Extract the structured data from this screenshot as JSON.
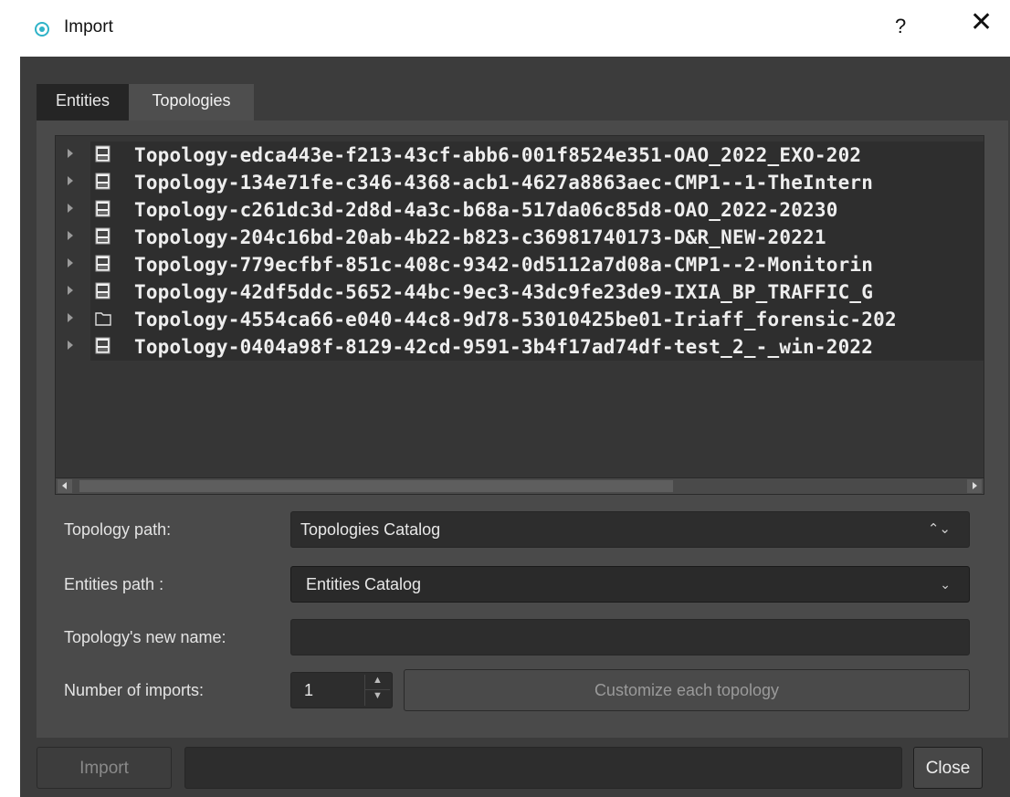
{
  "dialog": {
    "title": "Import",
    "help_label": "?",
    "close_glyph": "✕"
  },
  "tabs": [
    {
      "label": "Entities",
      "active": false
    },
    {
      "label": "Topologies",
      "active": true
    }
  ],
  "tree": {
    "rows": [
      {
        "label": "Topology-edca443e-f213-43cf-abb6-001f8524e351-OAO_2022_EXO-202",
        "icon": "topology-file-icon"
      },
      {
        "label": "Topology-134e71fe-c346-4368-acb1-4627a8863aec-CMP1--1-TheIntern",
        "icon": "topology-file-icon"
      },
      {
        "label": "Topology-c261dc3d-2d8d-4a3c-b68a-517da06c85d8-OAO_2022-20230",
        "icon": "topology-file-icon"
      },
      {
        "label": "Topology-204c16bd-20ab-4b22-b823-c36981740173-D&R_NEW-20221",
        "icon": "topology-file-icon"
      },
      {
        "label": "Topology-779ecfbf-851c-408c-9342-0d5112a7d08a-CMP1--2-Monitorin",
        "icon": "topology-file-icon"
      },
      {
        "label": "Topology-42df5ddc-5652-44bc-9ec3-43dc9fe23de9-IXIA_BP_TRAFFIC_G",
        "icon": "topology-file-icon"
      },
      {
        "label": "Topology-4554ca66-e040-44c8-9d78-53010425be01-Iriaff_forensic-202",
        "icon": "folder-icon"
      },
      {
        "label": "Topology-0404a98f-8129-42cd-9591-3b4f17ad74df-test_2_-_win-2022",
        "icon": "topology-file-icon"
      }
    ]
  },
  "form": {
    "topology_path_label": "Topology path:",
    "topology_path_value": "Topologies Catalog",
    "entities_path_label": "Entities path :",
    "entities_path_value": "Entities Catalog",
    "new_name_label": "Topology's new name:",
    "new_name_value": "",
    "imports_label": "Number of imports:",
    "imports_value": "1",
    "customize_label": "Customize each topology"
  },
  "footer": {
    "import_label": "Import",
    "status_text": "",
    "close_label": "Close"
  },
  "colors": {
    "accent": "#2fb3c8",
    "window_bg": "#3c3c3c",
    "panel_bg": "#4a4a4a",
    "tree_bg": "#363636"
  }
}
